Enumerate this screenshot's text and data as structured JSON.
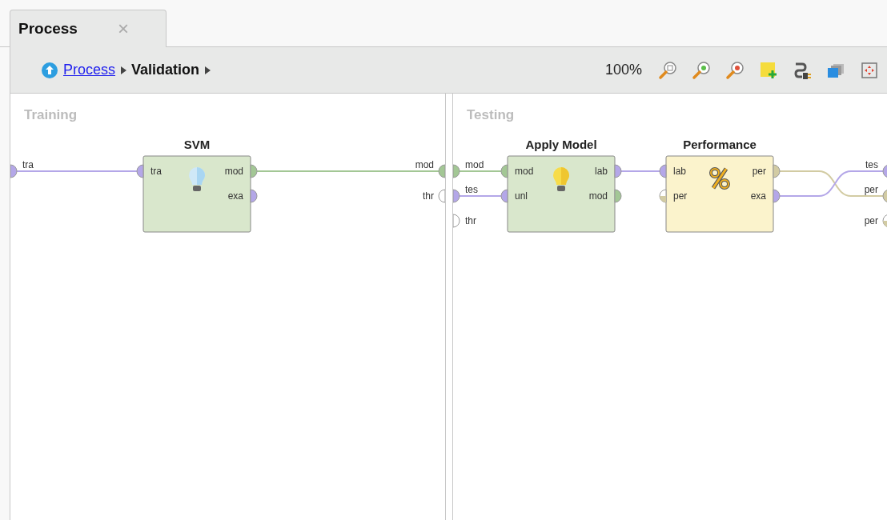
{
  "tab": {
    "label": "Process",
    "close": "×",
    "selected": true
  },
  "breadcrumb": [
    {
      "label": "Process",
      "kind": "link"
    },
    {
      "label": "Validation",
      "kind": "current"
    }
  ],
  "toolbar": {
    "zoom": "100%"
  },
  "panels": [
    {
      "title": "Training",
      "inputs": [
        {
          "label": "tra",
          "color": "#b4a7e8"
        }
      ],
      "outputs": [
        {
          "label": "mod",
          "color": "#a3c795"
        },
        {
          "label": "thr"
        }
      ],
      "operators": [
        {
          "title": "SVM",
          "kind": "learner",
          "inputs": [
            {
              "label": "tra",
              "color": "#b4a7e8"
            }
          ],
          "outputs": [
            {
              "label": "mod",
              "color": "#a3c795"
            },
            {
              "label": "exa",
              "color": "#b4a7e8"
            }
          ]
        }
      ]
    },
    {
      "title": "Testing",
      "inputs": [
        {
          "label": "mod",
          "color": "#a3c795"
        },
        {
          "label": "tes",
          "color": "#b4a7e8"
        },
        {
          "label": "thr"
        }
      ],
      "outputs": [
        {
          "label": "tes",
          "color": "#b4a7e8"
        },
        {
          "label": "per",
          "color": "#d2cba3"
        },
        {
          "label": "per",
          "color": "#d2cba3",
          "half": true
        }
      ],
      "operators": [
        {
          "title": "Apply Model",
          "kind": "applier",
          "inputs": [
            {
              "label": "mod",
              "color": "#a3c795"
            },
            {
              "label": "unl",
              "color": "#b4a7e8"
            }
          ],
          "outputs": [
            {
              "label": "lab",
              "color": "#b4a7e8"
            },
            {
              "label": "mod",
              "color": "#a3c795"
            }
          ]
        },
        {
          "title": "Performance",
          "kind": "evaluator",
          "inputs": [
            {
              "label": "lab",
              "color": "#b4a7e8"
            },
            {
              "label": "per",
              "color": "#d2cba3",
              "half": true
            }
          ],
          "outputs": [
            {
              "label": "per",
              "color": "#d2cba3"
            },
            {
              "label": "exa",
              "color": "#b4a7e8"
            }
          ]
        }
      ]
    }
  ]
}
